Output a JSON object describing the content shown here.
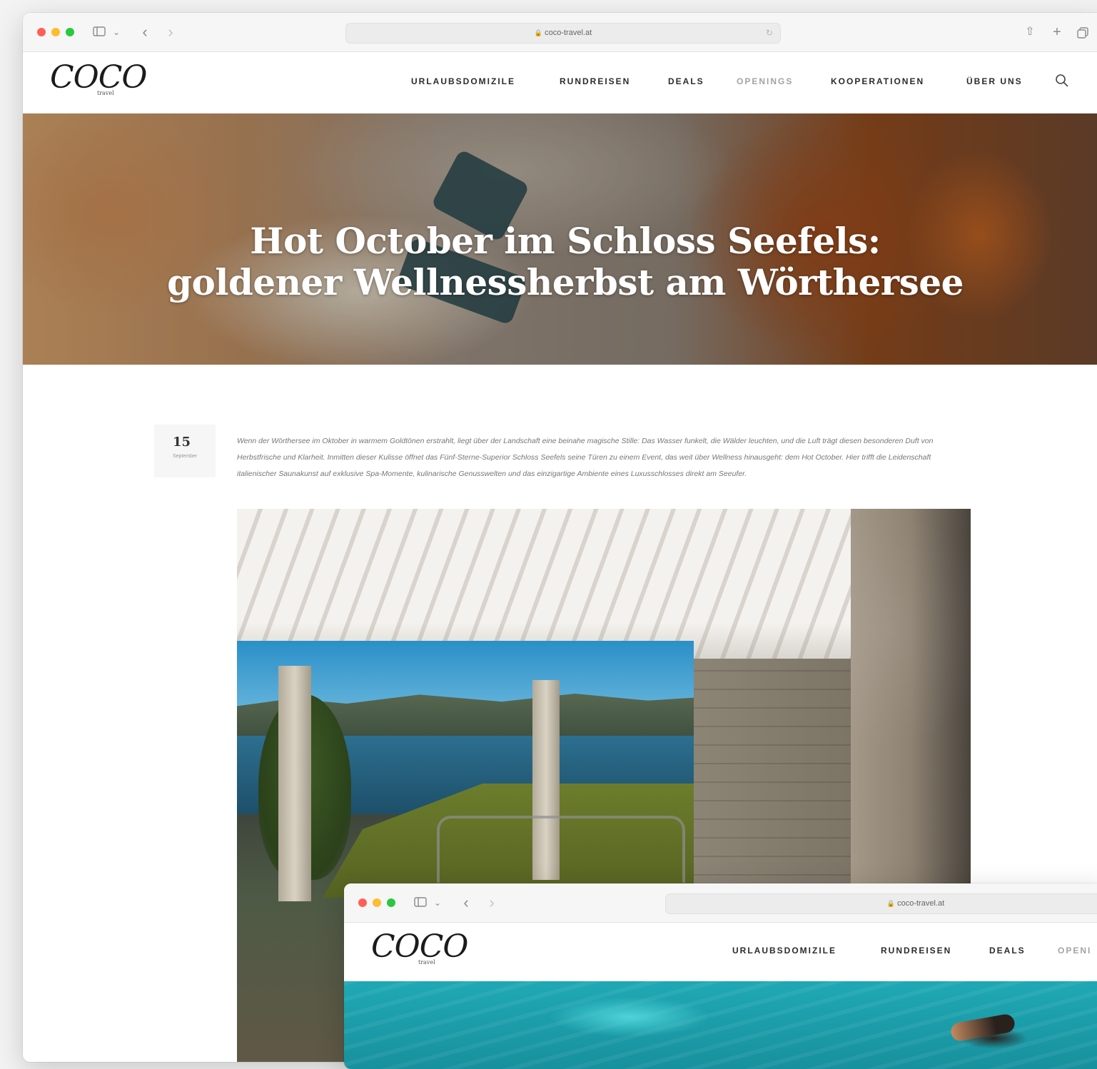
{
  "browser_main": {
    "url": "coco-travel.at"
  },
  "header": {
    "logo_text": "COCO",
    "logo_sub": "travel",
    "nav": [
      {
        "label": "URLAUBSDOMIZILE"
      },
      {
        "label": "RUNDREISEN"
      },
      {
        "label": "DEALS"
      },
      {
        "label": "OPENINGS"
      },
      {
        "label": "KOOPERATIONEN"
      },
      {
        "label": "ÜBER UNS"
      }
    ]
  },
  "hero": {
    "title": "Hot October im Schloss Seefels: goldener Wellnessherbst am Wörthersee"
  },
  "article": {
    "date_day": "15",
    "date_month": "September",
    "intro": "Wenn der Wörthersee im Oktober in warmem Goldtönen erstrahlt, liegt über der Landschaft eine beinahe magische Stille: Das Wasser funkelt, die Wälder leuchten, und die Luft trägt diesen besonderen Duft von Herbstfrische und Klarheit. Inmitten dieser Kulisse öffnet das Fünf-Sterne-Superior Schloss Seefels seine Türen zu einem Event, das weit über Wellness hinausgeht: dem Hot October. Hier trifft die Leidenschaft italienischer Saunakunst auf exklusive Spa-Momente, kulinarische Genusswelten und das einzigartige Ambiente eines Luxusschlosses direkt am Seeufer."
  },
  "browser_second": {
    "url": "coco-travel.at",
    "nav": [
      {
        "label": "URLAUBSDOMIZILE"
      },
      {
        "label": "RUNDREISEN"
      },
      {
        "label": "DEALS"
      },
      {
        "label": "OPENI"
      }
    ]
  }
}
